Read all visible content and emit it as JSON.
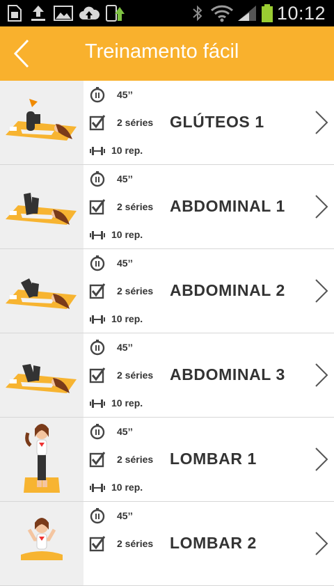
{
  "status_bar": {
    "time": "10:12"
  },
  "header": {
    "title": "Treinamento fácil"
  },
  "colors": {
    "accent": "#f9b12d",
    "text": "#333333",
    "thumb_bg": "#efefef",
    "divider": "#d6d6d6"
  },
  "exercises": [
    {
      "title": "GLÚTEOS 1",
      "duration": "45’’",
      "series": "2 séries",
      "reps": "10 rep.",
      "illustration": "lying-leg-raise"
    },
    {
      "title": "ABDOMINAL 1",
      "duration": "45’’",
      "series": "2 séries",
      "reps": "10 rep.",
      "illustration": "lying-crunch"
    },
    {
      "title": "ABDOMINAL 2",
      "duration": "45’’",
      "series": "2 séries",
      "reps": "10 rep.",
      "illustration": "lying-crunch"
    },
    {
      "title": "ABDOMINAL 3",
      "duration": "45’’",
      "series": "2 séries",
      "reps": "10 rep.",
      "illustration": "lying-crunch"
    },
    {
      "title": "LOMBAR 1",
      "duration": "45’’",
      "series": "2 séries",
      "reps": "10 rep.",
      "illustration": "standing"
    },
    {
      "title": "LOMBAR 2",
      "duration": "45’’",
      "series": "2 séries",
      "reps": "",
      "illustration": "seated"
    }
  ]
}
